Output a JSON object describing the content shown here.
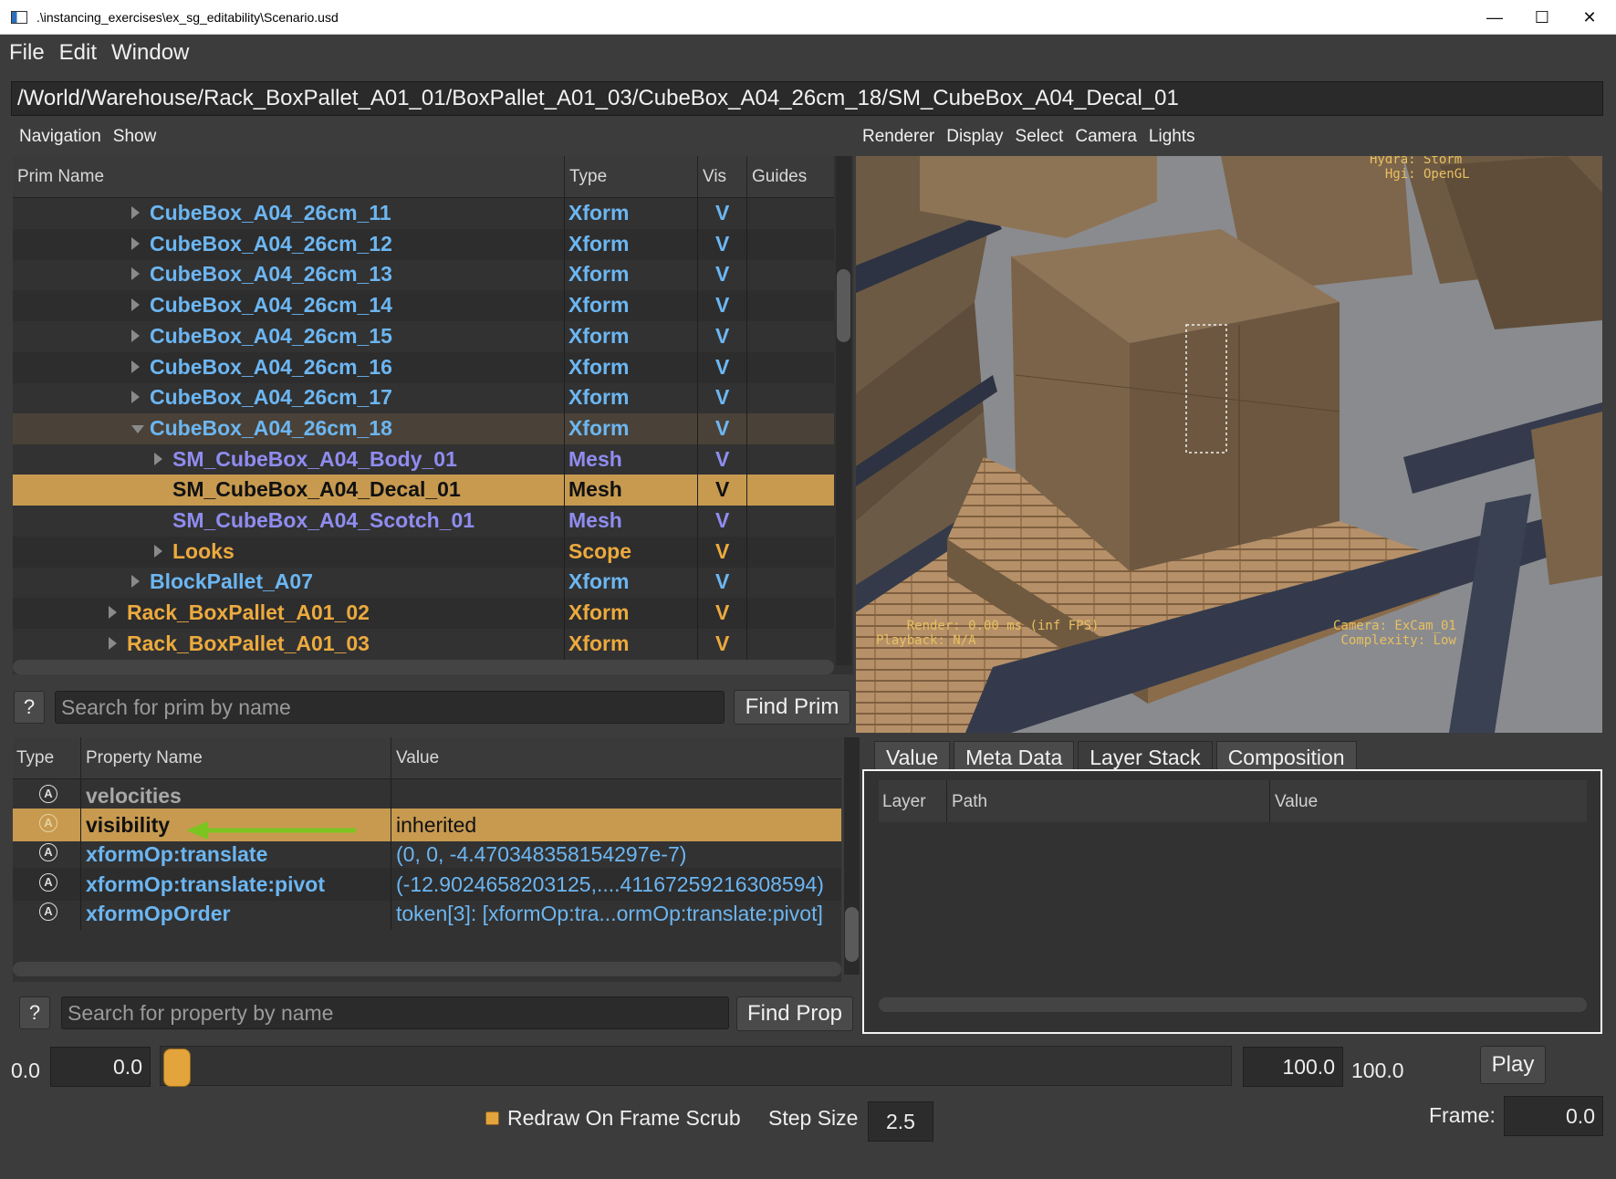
{
  "window": {
    "title": ".\\instancing_exercises\\ex_sg_editability\\Scenario.usd",
    "minimize": "—",
    "maximize": "☐",
    "close": "✕"
  },
  "menu": [
    "File",
    "Edit",
    "Window"
  ],
  "path": "/World/Warehouse/Rack_BoxPallet_A01_01/BoxPallet_A01_03/CubeBox_A04_26cm_18/SM_CubeBox_A04_Decal_01",
  "prim_pane": {
    "menu": [
      "Navigation",
      "Show"
    ],
    "columns": {
      "name": "Prim Name",
      "type": "Type",
      "vis": "Vis",
      "guides": "Guides"
    },
    "rows": [
      {
        "name": "CubeBox_A04_26cm_11",
        "type": "Xform",
        "vis": "V",
        "depth": 0,
        "color": "blue",
        "state": "collapsed"
      },
      {
        "name": "CubeBox_A04_26cm_12",
        "type": "Xform",
        "vis": "V",
        "depth": 0,
        "color": "blue",
        "state": "collapsed"
      },
      {
        "name": "CubeBox_A04_26cm_13",
        "type": "Xform",
        "vis": "V",
        "depth": 0,
        "color": "blue",
        "state": "collapsed"
      },
      {
        "name": "CubeBox_A04_26cm_14",
        "type": "Xform",
        "vis": "V",
        "depth": 0,
        "color": "blue",
        "state": "collapsed"
      },
      {
        "name": "CubeBox_A04_26cm_15",
        "type": "Xform",
        "vis": "V",
        "depth": 0,
        "color": "blue",
        "state": "collapsed"
      },
      {
        "name": "CubeBox_A04_26cm_16",
        "type": "Xform",
        "vis": "V",
        "depth": 0,
        "color": "blue",
        "state": "collapsed"
      },
      {
        "name": "CubeBox_A04_26cm_17",
        "type": "Xform",
        "vis": "V",
        "depth": 0,
        "color": "blue",
        "state": "collapsed"
      },
      {
        "name": "CubeBox_A04_26cm_18",
        "type": "Xform",
        "vis": "V",
        "depth": 0,
        "color": "blue",
        "state": "expanded"
      },
      {
        "name": "SM_CubeBox_A04_Body_01",
        "type": "Mesh",
        "vis": "V",
        "depth": 1,
        "color": "purple",
        "state": "collapsed"
      },
      {
        "name": "SM_CubeBox_A04_Decal_01",
        "type": "Mesh",
        "vis": "V",
        "depth": 1,
        "color": "dark",
        "state": "selected"
      },
      {
        "name": "SM_CubeBox_A04_Scotch_01",
        "type": "Mesh",
        "vis": "V",
        "depth": 1,
        "color": "purple",
        "state": "leaf"
      },
      {
        "name": "Looks",
        "type": "Scope",
        "vis": "V",
        "depth": 1,
        "color": "orange",
        "state": "collapsed"
      },
      {
        "name": "BlockPallet_A07",
        "type": "Xform",
        "vis": "V",
        "depth": 0,
        "color": "blue",
        "state": "collapsed"
      },
      {
        "name": "Rack_BoxPallet_A01_02",
        "type": "Xform",
        "vis": "V",
        "depth": -1,
        "color": "orange",
        "state": "collapsed"
      },
      {
        "name": "Rack_BoxPallet_A01_03",
        "type": "Xform",
        "vis": "V",
        "depth": -1,
        "color": "orange",
        "state": "collapsed"
      }
    ],
    "search_placeholder": "Search for prim by name",
    "help": "?",
    "find": "Find Prim"
  },
  "viewport": {
    "menu": [
      "Renderer",
      "Display",
      "Select",
      "Camera",
      "Lights"
    ],
    "hud_top_right": "Hydra: Storm\n  Hgi: OpenGL",
    "hud_bottom_left": "    Render: 0.00 ms (inf FPS)\nPlayback: N/A",
    "hud_bottom_right": "Camera: ExCam_01\nComplexity: Low"
  },
  "property_pane": {
    "columns": {
      "type": "Type",
      "name": "Property Name",
      "value": "Value"
    },
    "rows": [
      {
        "icon": "A",
        "name": "velocities",
        "value": "",
        "color": "gray",
        "state": "normal"
      },
      {
        "icon": "A",
        "name": "visibility",
        "value": "inherited",
        "color": "dark",
        "state": "selected"
      },
      {
        "icon": "A",
        "name": "xformOp:translate",
        "value": "(0, 0, -4.470348358154297e-7)",
        "color": "blue",
        "state": "normal"
      },
      {
        "icon": "A",
        "name": "xformOp:translate:pivot",
        "value": "(-12.9024658203125,....41167259216308594)",
        "color": "blue",
        "state": "normal"
      },
      {
        "icon": "A",
        "name": "xformOpOrder",
        "value": "token[3]: [xformOp:tra...ormOp:translate:pivot]",
        "color": "blue",
        "state": "normal"
      }
    ],
    "search_placeholder": "Search for property by name",
    "help": "?",
    "find": "Find Prop"
  },
  "inspector": {
    "tabs": [
      "Value",
      "Meta Data",
      "Layer Stack",
      "Composition"
    ],
    "active_tab": "Layer Stack",
    "columns": {
      "layer": "Layer",
      "path": "Path",
      "value": "Value"
    }
  },
  "timeline": {
    "start_label": "0.0",
    "start_value": "0.0",
    "end_value": "100.0",
    "end_label": "100.0",
    "current_fraction": 0.0,
    "play": "Play",
    "redraw_label": "Redraw On Frame Scrub",
    "redraw_checked": true,
    "step_label": "Step Size",
    "step_value": "2.5",
    "frame_label": "Frame:",
    "frame_value": "0.0"
  },
  "colors": {
    "accent": "#c79a50",
    "prim_blue": "#6cb6f2",
    "prim_purple": "#8f8cf0",
    "prim_orange": "#ecaa3e",
    "annotation_arrow": "#7cc520"
  }
}
